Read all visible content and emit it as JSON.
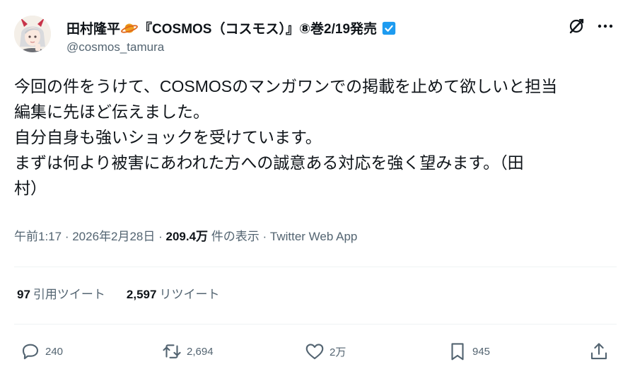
{
  "author": {
    "display_name_prefix": "田村隆平",
    "display_name_suffix": "『COSMOS（コスモス）』⑧巻2/19発売",
    "handle": "@cosmos_tamura",
    "verified": true
  },
  "tweet": {
    "lines": [
      "今回の件をうけて、COSMOSのマンガワンでの掲載を止めて欲しいと担当",
      "編集に先ほど伝えました。",
      "自分自身も強いショックを受けています。",
      "まずは何より被害にあわれた方への誠意ある対応を強く望みます。（田",
      "村）"
    ]
  },
  "meta": {
    "time": "午前1:17",
    "separator": " · ",
    "date": "2026年2月28日",
    "views_count": "209.4万",
    "views_label": " 件の表示",
    "source": "Twitter Web App"
  },
  "stats": {
    "quotes_count": "97",
    "quotes_label": "引用ツイート",
    "retweets_count": "2,597",
    "retweets_label": "リツイート"
  },
  "actions": {
    "replies": "240",
    "retweets": "2,694",
    "likes": "2万",
    "bookmarks": "945"
  },
  "colors": {
    "text_primary": "#0f1419",
    "text_secondary": "#536471",
    "verified_blue": "#1d9bf0",
    "divider": "#eff3f4"
  },
  "icons": {
    "avatar": "avatar",
    "planet": "ringed-planet-icon",
    "verified": "verified-badge-icon",
    "grok": "grok-icon",
    "more": "more-icon",
    "reply": "reply-icon",
    "retweet": "retweet-icon",
    "like": "like-icon",
    "bookmark": "bookmark-icon",
    "share": "share-icon"
  }
}
